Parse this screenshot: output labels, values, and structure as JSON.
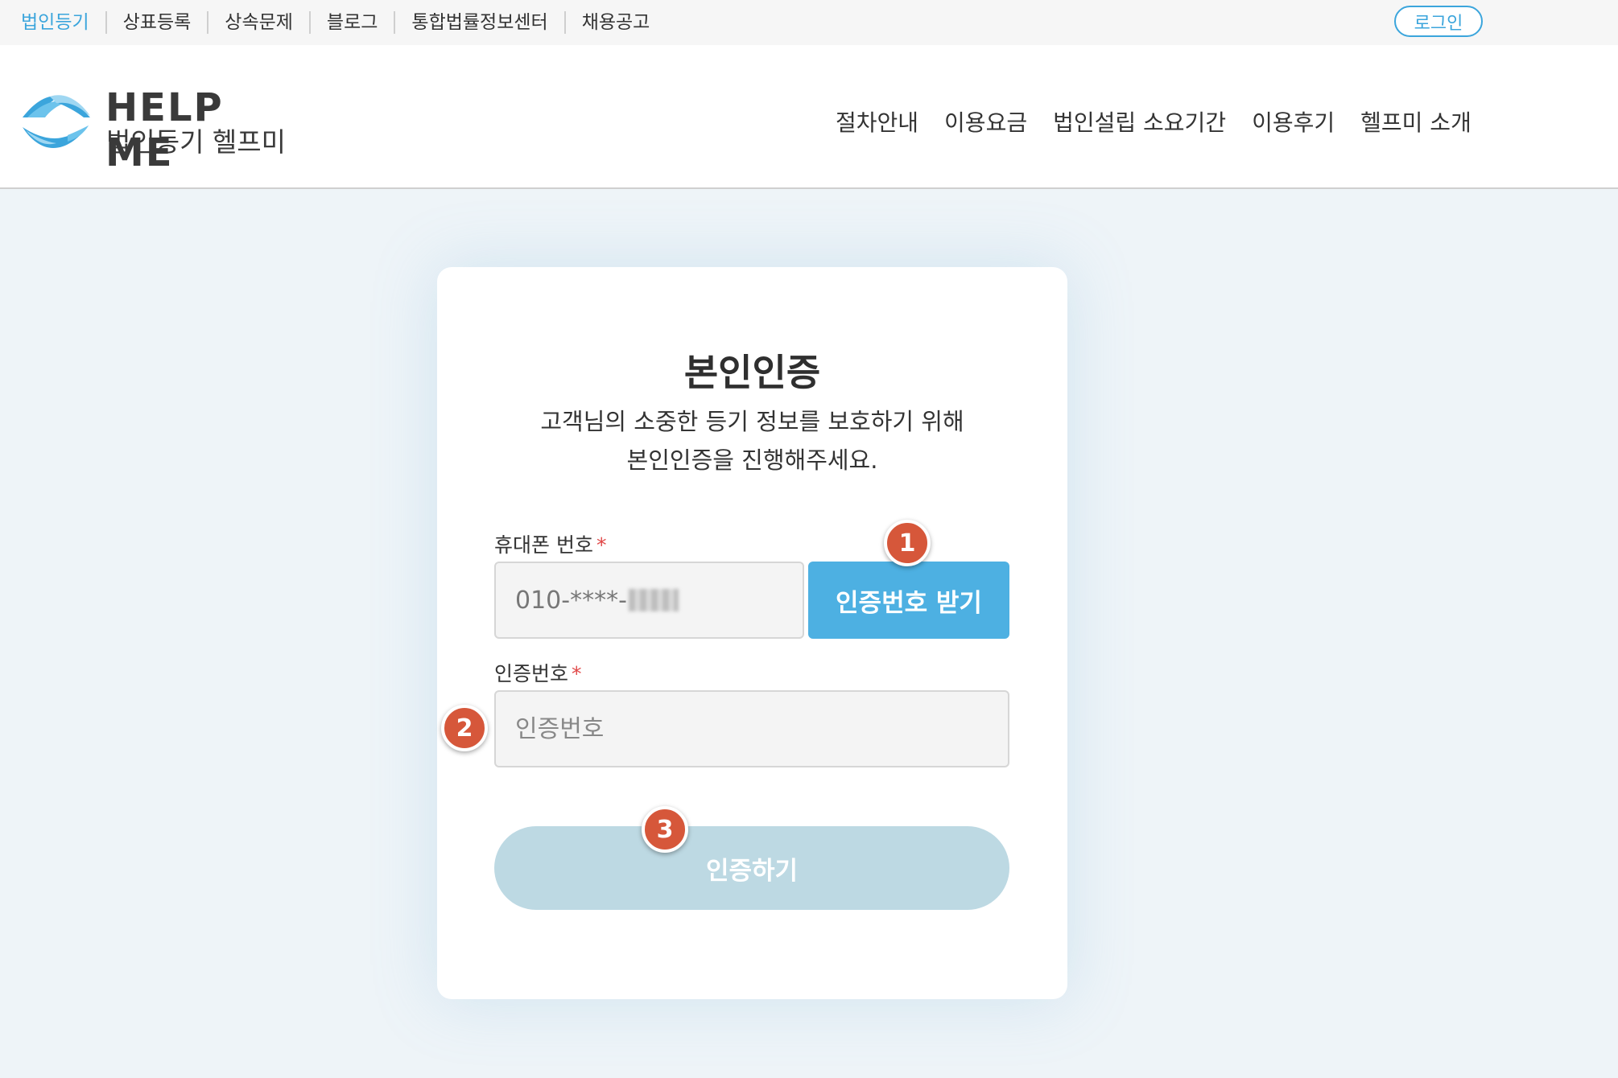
{
  "topbar": {
    "links": [
      {
        "label": "법인등기",
        "active": true
      },
      {
        "label": "상표등록",
        "active": false
      },
      {
        "label": "상속문제",
        "active": false
      },
      {
        "label": "블로그",
        "active": false
      },
      {
        "label": "통합법률정보센터",
        "active": false
      },
      {
        "label": "채용공고",
        "active": false
      }
    ],
    "login_label": "로그인"
  },
  "header": {
    "logo_icon": "helpme-wave-logo-icon",
    "logo_en": "HELP ME",
    "logo_ko": "법인등기 헬프미",
    "nav": [
      "절차안내",
      "이용요금",
      "법인설립 소요기간",
      "이용후기",
      "헬프미 소개"
    ]
  },
  "auth": {
    "title": "본인인증",
    "subtitle_line1": "고객님의 소중한 등기 정보를 보호하기 위해",
    "subtitle_line2": "본인인증을 진행해주세요.",
    "phone_label": "휴대폰 번호",
    "phone_required": "*",
    "phone_value": "010-****-",
    "otp_button": "인증번호 받기",
    "code_label": "인증번호",
    "code_required": "*",
    "code_placeholder": "인증번호",
    "verify_button": "인증하기"
  },
  "steps": [
    "1",
    "2",
    "3"
  ],
  "colors": {
    "accent": "#3ba5dc",
    "otp_button": "#4db0e2",
    "verify_button_disabled": "#bdd9e3",
    "step_marker": "#d6573a",
    "required": "#e04848",
    "page_bg": "#eef4f8"
  }
}
